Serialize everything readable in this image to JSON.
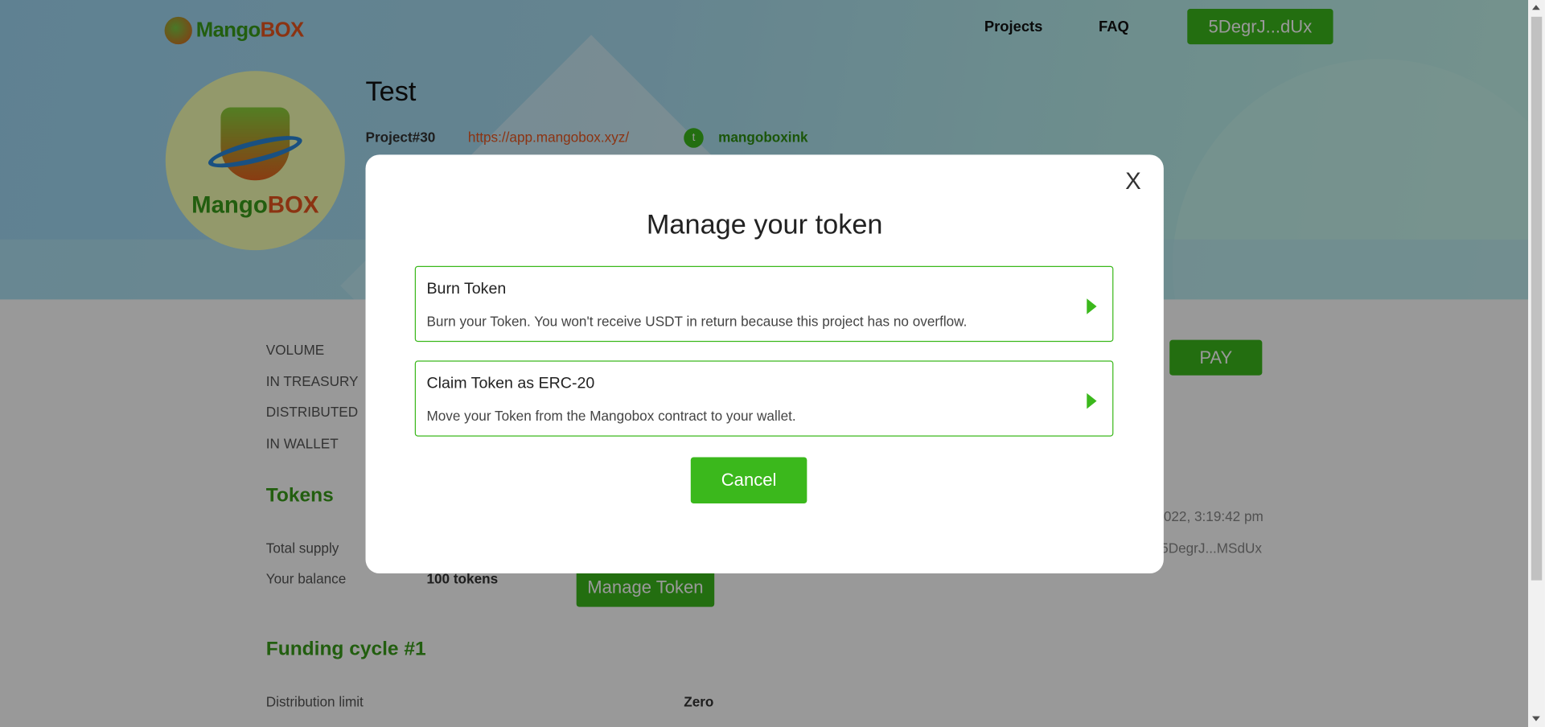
{
  "nav": {
    "logo_a": "Mango",
    "logo_b": "BOX",
    "projects": "Projects",
    "faq": "FAQ",
    "wallet": "5DegrJ...dUx"
  },
  "project": {
    "title": "Test",
    "number": "Project#30",
    "url": "https://app.mangobox.xyz/",
    "twitter": "mangoboxink",
    "avatar_a": "Mango",
    "avatar_b": "BOX"
  },
  "stats": {
    "volume": "VOLUME",
    "treasury": "IN TREASURY",
    "distributed": "DISTRIBUTED",
    "wallet": "IN WALLET",
    "pay": "PAY"
  },
  "tokens": {
    "heading": "Tokens",
    "total_supply_label": "Total supply",
    "balance_label": "Your balance",
    "balance_value": "100 tokens",
    "manage": "Manage Token",
    "side_date": "022, 3:19:42 pm",
    "side_owner": "5DegrJ...MSdUx"
  },
  "funding": {
    "heading": "Funding cycle #1",
    "limit_label": "Distribution limit",
    "limit_value": "Zero"
  },
  "modal": {
    "close": "X",
    "title": "Manage your token",
    "options": [
      {
        "title": "Burn Token",
        "desc": "Burn your Token. You won't receive USDT in return because this project has no overflow."
      },
      {
        "title": "Claim Token as ERC-20",
        "desc": "Move your Token from the Mangobox contract to your wallet."
      }
    ],
    "cancel": "Cancel"
  },
  "colors": {
    "accent": "#3bb81c",
    "brand_orange": "#e8561e",
    "heading_green": "#3a9d1a"
  }
}
